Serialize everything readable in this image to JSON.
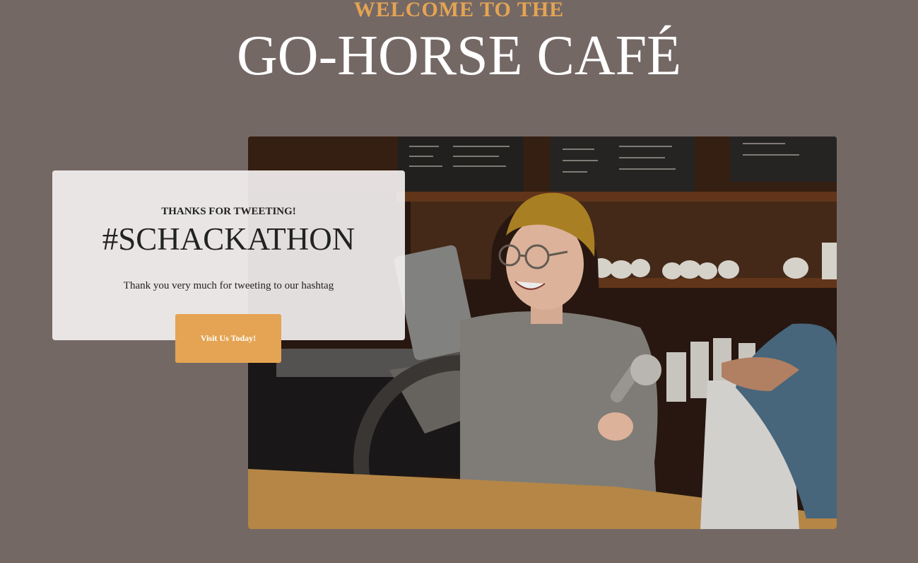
{
  "header": {
    "kicker": "WELCOME TO THE",
    "title": "GO-HORSE CAFÉ"
  },
  "card": {
    "kicker": "THANKS FOR TWEETING!",
    "title": "#SCHACKATHON",
    "text": "Thank you very much for tweeting to our hashtag"
  },
  "cta": {
    "label": "Visit Us Today!"
  },
  "colors": {
    "background": "#746865",
    "accent": "#e5a453",
    "card": "#f3f0f0",
    "text_dark": "#222222"
  }
}
